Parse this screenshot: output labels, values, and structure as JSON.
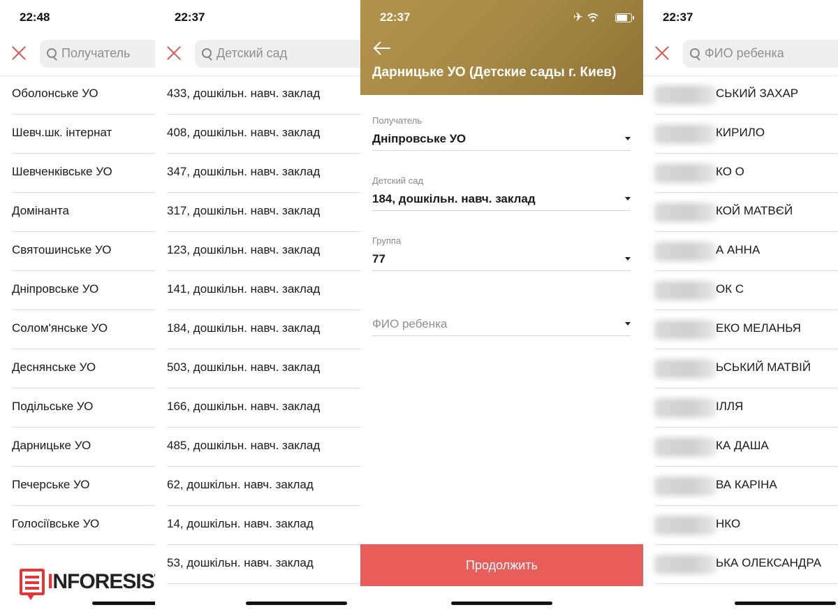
{
  "panel1": {
    "time": "22:48",
    "search_placeholder": "Получатель",
    "items": [
      "Оболонське УО",
      "Шевч.шк. інтернат",
      "Шевченківське УО",
      "Домінанта",
      "Святошинське УО",
      "Дніпровське УО",
      "Солом'янське УО",
      "Деснянське УО",
      "Подільське УО",
      "Дарницьке УО",
      "Печерське УО",
      "Голосіївське УО"
    ]
  },
  "panel2": {
    "time": "22:37",
    "search_placeholder": "Детский сад",
    "items": [
      "433, дошкільн. навч. заклад",
      "408, дошкільн. навч. заклад",
      "347, дошкільн. навч. заклад",
      "317, дошкільн. навч. заклад",
      "123, дошкільн. навч. заклад",
      "141, дошкільн. навч. заклад",
      "184, дошкільн. навч. заклад",
      "503, дошкільн. навч. заклад",
      "166, дошкільн. навч. заклад",
      "485, дошкільн. навч. заклад",
      "62, дошкільн. навч. заклад",
      "14, дошкільн. навч. заклад",
      "53, дошкільн. навч. заклад"
    ]
  },
  "panel3": {
    "time": "22:37",
    "title": "Дарницьке УО (Детские сады г. Киев)",
    "fields": [
      {
        "label": "Получатель",
        "value": "Дніпровське УО"
      },
      {
        "label": "Детский сад",
        "value": "184, дошкільн. навч. заклад"
      },
      {
        "label": "Группа",
        "value": "77"
      },
      {
        "placeholder": "ФИО ребенка"
      }
    ],
    "continue_label": "Продолжить",
    "header_color": "#a88a45",
    "button_color": "#e85c5a"
  },
  "panel4": {
    "time": "22:37",
    "search_placeholder": "ФИО ребенка",
    "items": [
      "СЬКИЙ ЗАХАР",
      "КИРИЛО",
      "КО О",
      "КОЙ МАТВЄЙ",
      "А АННА",
      "ОК С",
      "ЕКО МЕЛАНЬЯ",
      "ЬСЬКИЙ МАТВІЙ",
      "ІЛЛЯ",
      "КА ДАША",
      "ВА КАРІНА",
      "НКО",
      "ЬКА ОЛЕКСАНДРА"
    ]
  },
  "logo": {
    "text_a": "I",
    "text_b": "NFORESIST",
    "accent_color": "#e33737"
  },
  "icons": [
    "close-icon",
    "search-icon",
    "back-arrow-icon",
    "airplane-icon",
    "wifi-icon",
    "battery-icon",
    "dropdown-caret-icon"
  ]
}
